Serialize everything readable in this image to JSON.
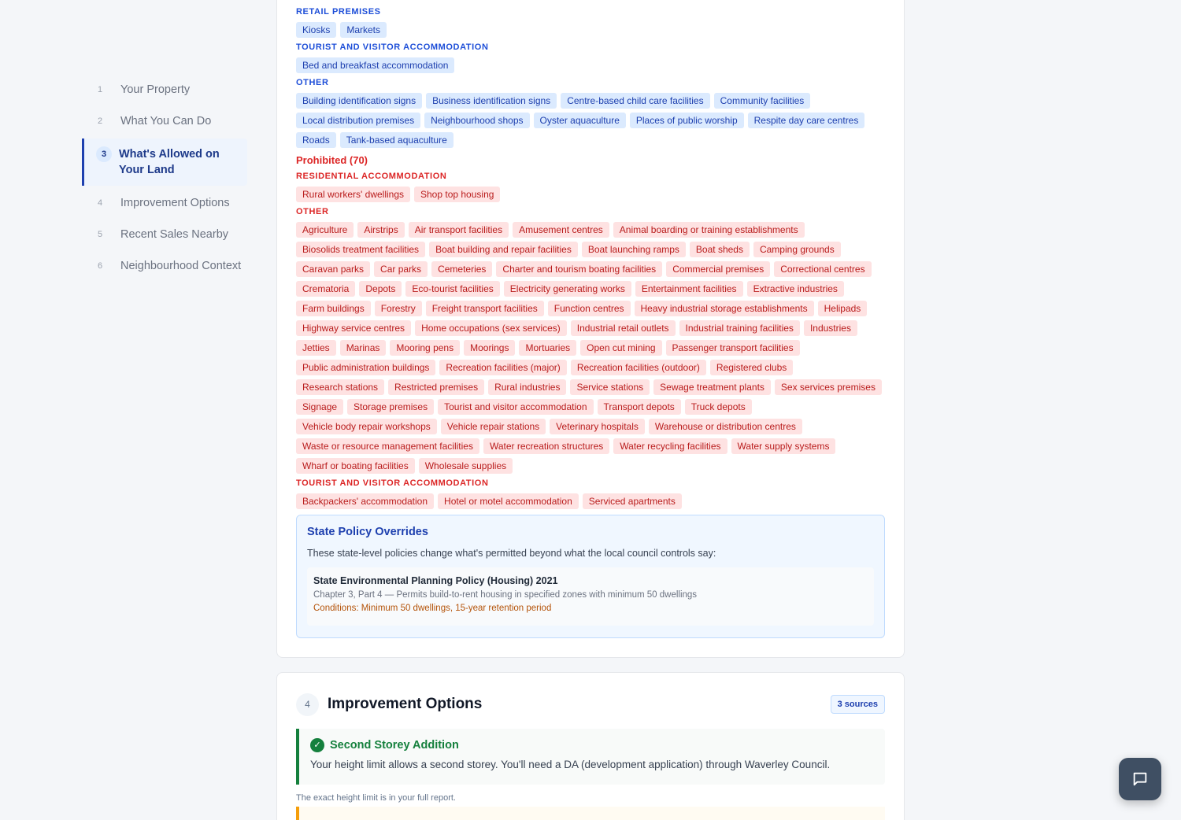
{
  "sidebar": {
    "items": [
      {
        "num": "1",
        "label": "Your Property"
      },
      {
        "num": "2",
        "label": "What You Can Do"
      },
      {
        "num": "3",
        "label": "What's Allowed on Your Land"
      },
      {
        "num": "4",
        "label": "Improvement Options"
      },
      {
        "num": "5",
        "label": "Recent Sales Nearby"
      },
      {
        "num": "6",
        "label": "Neighbourhood Context"
      }
    ],
    "active_index": 2
  },
  "permitted": {
    "groups": [
      {
        "heading": "RETAIL PREMISES",
        "items": [
          "Kiosks",
          "Markets"
        ]
      },
      {
        "heading": "TOURIST AND VISITOR ACCOMMODATION",
        "items": [
          "Bed and breakfast accommodation"
        ]
      },
      {
        "heading": "OTHER",
        "items": [
          "Building identification signs",
          "Business identification signs",
          "Centre-based child care facilities",
          "Community facilities",
          "Local distribution premises",
          "Neighbourhood shops",
          "Oyster aquaculture",
          "Places of public worship",
          "Respite day care centres",
          "Roads",
          "Tank-based aquaculture"
        ]
      }
    ]
  },
  "prohibited": {
    "title": "Prohibited (70)",
    "groups": [
      {
        "heading": "RESIDENTIAL ACCOMMODATION",
        "items": [
          "Rural workers' dwellings",
          "Shop top housing"
        ]
      },
      {
        "heading": "OTHER",
        "items": [
          "Agriculture",
          "Airstrips",
          "Air transport facilities",
          "Amusement centres",
          "Animal boarding or training establishments",
          "Biosolids treatment facilities",
          "Boat building and repair facilities",
          "Boat launching ramps",
          "Boat sheds",
          "Camping grounds",
          "Caravan parks",
          "Car parks",
          "Cemeteries",
          "Charter and tourism boating facilities",
          "Commercial premises",
          "Correctional centres",
          "Crematoria",
          "Depots",
          "Eco-tourist facilities",
          "Electricity generating works",
          "Entertainment facilities",
          "Extractive industries",
          "Farm buildings",
          "Forestry",
          "Freight transport facilities",
          "Function centres",
          "Heavy industrial storage establishments",
          "Helipads",
          "Highway service centres",
          "Home occupations (sex services)",
          "Industrial retail outlets",
          "Industrial training facilities",
          "Industries",
          "Jetties",
          "Marinas",
          "Mooring pens",
          "Moorings",
          "Mortuaries",
          "Open cut mining",
          "Passenger transport facilities",
          "Public administration buildings",
          "Recreation facilities (major)",
          "Recreation facilities (outdoor)",
          "Registered clubs",
          "Research stations",
          "Restricted premises",
          "Rural industries",
          "Service stations",
          "Sewage treatment plants",
          "Sex services premises",
          "Signage",
          "Storage premises",
          "Tourist and visitor accommodation",
          "Transport depots",
          "Truck depots",
          "Vehicle body repair workshops",
          "Vehicle repair stations",
          "Veterinary hospitals",
          "Warehouse or distribution centres",
          "Waste or resource management facilities",
          "Water recreation structures",
          "Water recycling facilities",
          "Water supply systems",
          "Wharf or boating facilities",
          "Wholesale supplies"
        ]
      },
      {
        "heading": "TOURIST AND VISITOR ACCOMMODATION",
        "items": [
          "Backpackers' accommodation",
          "Hotel or motel accommodation",
          "Serviced apartments"
        ]
      }
    ]
  },
  "policy": {
    "title": "State Policy Overrides",
    "description": "These state-level policies change what's permitted beyond what the local council controls say:",
    "items": [
      {
        "name": "State Environmental Planning Policy (Housing) 2021",
        "detail": "Chapter 3, Part 4 — Permits build-to-rent housing in specified zones with minimum 50 dwellings",
        "conditions": "Conditions: Minimum 50 dwellings, 15-year retention period"
      }
    ]
  },
  "improvement": {
    "num": "4",
    "title": "Improvement Options",
    "sources": "3 sources",
    "option_title": "Second Storey Addition",
    "option_desc": "Your height limit allows a second storey. You'll need a DA (development application) through Waverley Council.",
    "note": "The exact height limit is in your full report."
  },
  "colors": {
    "accent": "#1e40af",
    "permitted_chip": "#dbeafe",
    "prohibited_chip": "#fee2e2",
    "success": "#15803d",
    "warning": "#f59e0b"
  },
  "icons": {
    "check": "check-icon",
    "chat": "chat-icon"
  }
}
